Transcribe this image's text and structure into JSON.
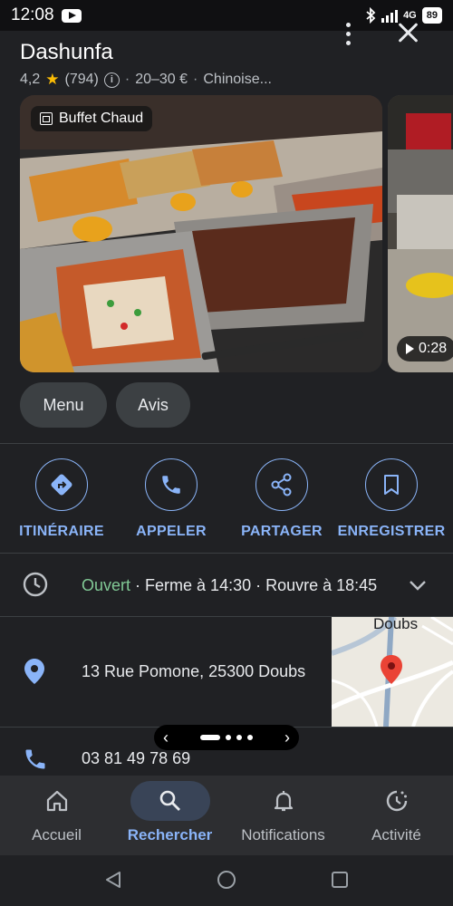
{
  "status_bar": {
    "time": "12:08",
    "network": "4G",
    "battery": "89"
  },
  "place": {
    "name": "Dashunfa",
    "rating": "4,2",
    "reviews": "(794)",
    "price": "20–30 €",
    "category": "Chinoise..."
  },
  "photos": {
    "main_label": "Buffet Chaud",
    "video_duration": "0:28"
  },
  "chips": {
    "menu": "Menu",
    "reviews": "Avis"
  },
  "actions": [
    {
      "label": "ITINÉRAIRE",
      "icon": "directions-icon"
    },
    {
      "label": "APPELER",
      "icon": "phone-icon"
    },
    {
      "label": "PARTAGER",
      "icon": "share-icon"
    },
    {
      "label": "ENREGISTRER",
      "icon": "bookmark-icon"
    }
  ],
  "hours": {
    "status": "Ouvert",
    "close": "· Ferme à 14:30 · Rouvre à 18:45"
  },
  "address": "13 Rue Pomone, 25300 Doubs",
  "map_label": "Doubs",
  "phone": "03 81 49 78 69",
  "bottom_nav": [
    {
      "label": "Accueil",
      "icon": "home-icon"
    },
    {
      "label": "Rechercher",
      "icon": "search-icon",
      "active": true
    },
    {
      "label": "Notifications",
      "icon": "bell-icon"
    },
    {
      "label": "Activité",
      "icon": "activity-icon"
    }
  ],
  "colors": {
    "accent": "#8ab4f8",
    "open": "#81c995",
    "star": "#fbbc04",
    "background": "#202124"
  }
}
